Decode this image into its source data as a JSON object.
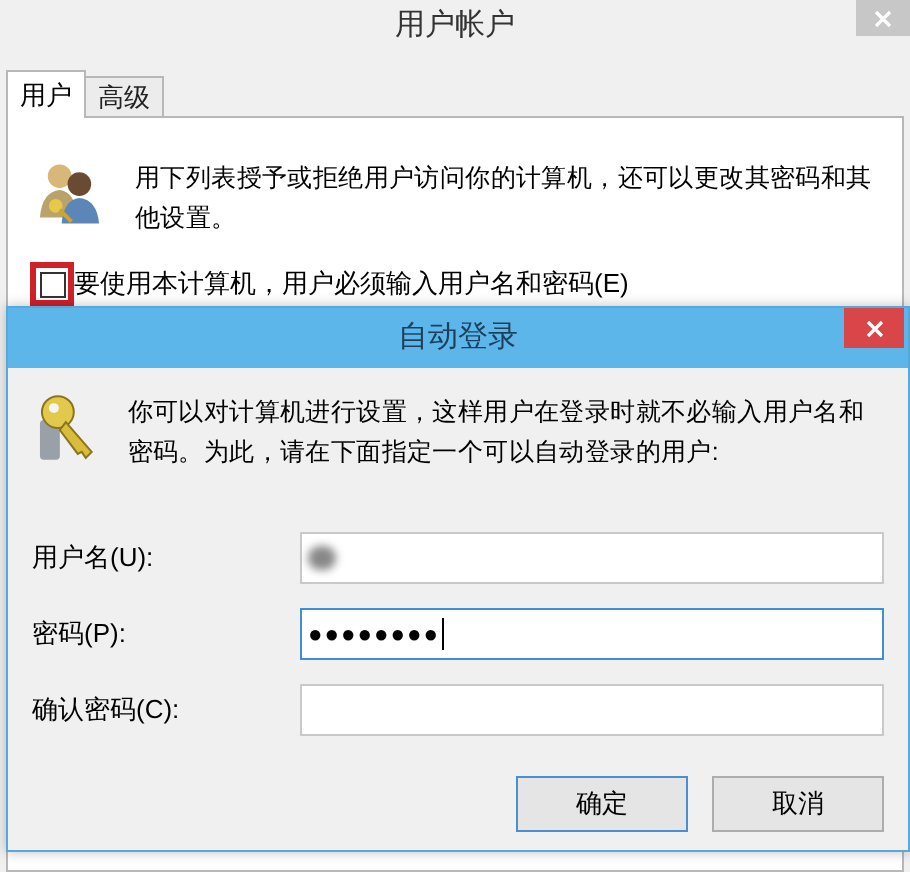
{
  "window": {
    "title": "用户帐户"
  },
  "tabs": [
    {
      "label": "用户",
      "selected": true
    },
    {
      "label": "高级",
      "selected": false
    }
  ],
  "intro": "用下列表授予或拒绝用户访问你的计算机，还可以更改其密码和其他设置。",
  "require_password": {
    "label": "要使用本计算机，用户必须输入用户名和密码(E)",
    "checked": false,
    "highlighted": true
  },
  "dialog": {
    "title": "自动登录",
    "message": "你可以对计算机进行设置，这样用户在登录时就不必输入用户名和密码。为此，请在下面指定一个可以自动登录的用户:",
    "fields": [
      {
        "label": "用户名(U):",
        "kind": "redacted",
        "focused": false
      },
      {
        "label": "密码(P):",
        "kind": "text",
        "value": "●●●●●●●●",
        "focused": true
      },
      {
        "label": "确认密码(C):",
        "kind": "text",
        "focused": false
      }
    ],
    "buttons": [
      "确定",
      "取消"
    ]
  }
}
